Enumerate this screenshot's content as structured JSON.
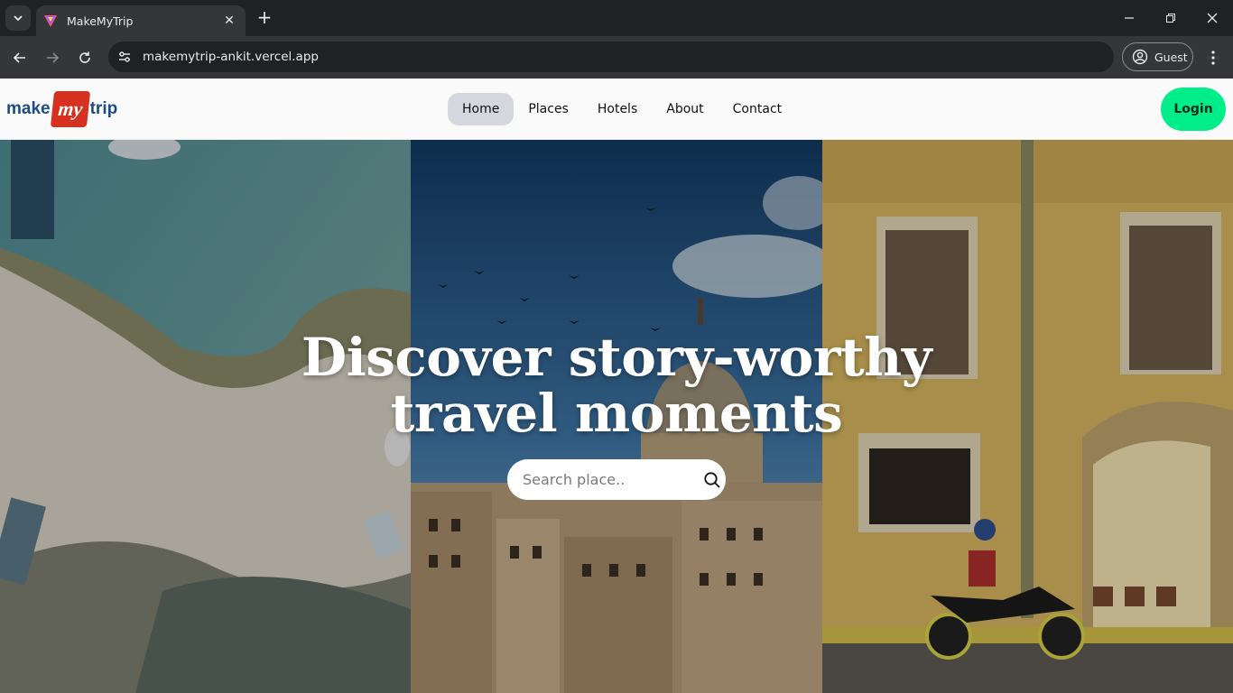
{
  "browser": {
    "tab_title": "MakeMyTrip",
    "url": "makemytrip-ankit.vercel.app",
    "profile_label": "Guest"
  },
  "site": {
    "logo": {
      "left": "make",
      "middle": "my",
      "right": "trip"
    },
    "nav": [
      {
        "label": "Home",
        "active": true
      },
      {
        "label": "Places",
        "active": false
      },
      {
        "label": "Hotels",
        "active": false
      },
      {
        "label": "About",
        "active": false
      },
      {
        "label": "Contact",
        "active": false
      }
    ],
    "login_label": "Login",
    "accent_color": "#00ee8a"
  },
  "hero": {
    "title_line1": "Discover story-worthy",
    "title_line2": "travel moments",
    "search_placeholder": "Search place..",
    "panels": [
      "beach-aerial-photo",
      "city-dome-photo",
      "colonial-street-photo"
    ]
  }
}
